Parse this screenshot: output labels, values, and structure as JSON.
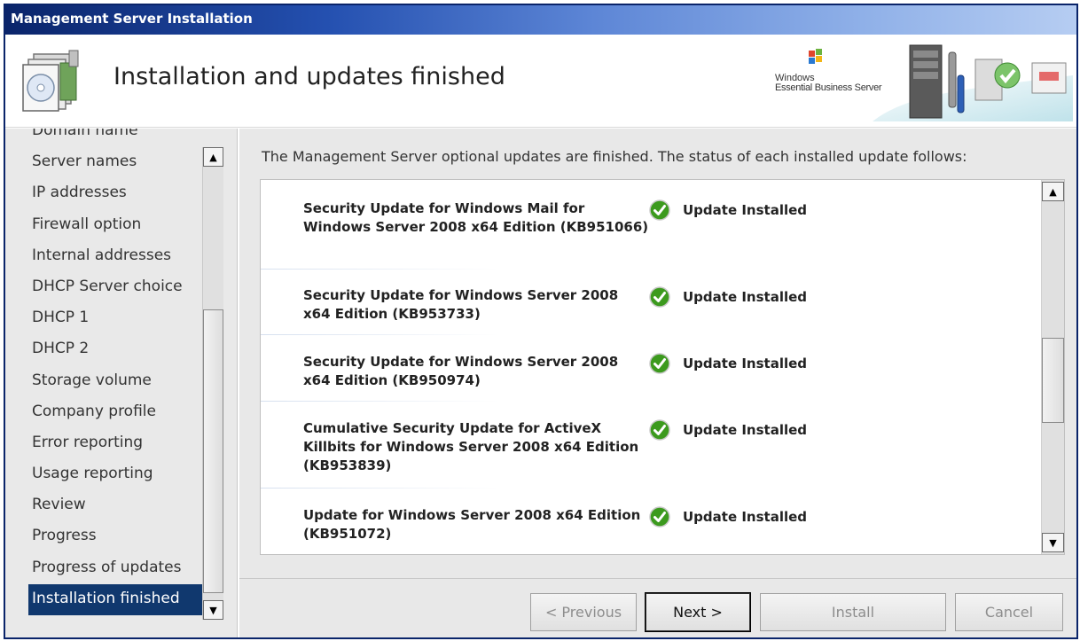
{
  "window": {
    "title": "Management Server Installation"
  },
  "header": {
    "page_title": "Installation and updates finished",
    "brand_line1": "Windows",
    "brand_line2": "Essential Business Server"
  },
  "sidebar": {
    "items": [
      {
        "label": "Domain name"
      },
      {
        "label": "Server names"
      },
      {
        "label": "IP addresses"
      },
      {
        "label": "Firewall option"
      },
      {
        "label": "Internal addresses"
      },
      {
        "label": "DHCP Server choice"
      },
      {
        "label": "DHCP 1"
      },
      {
        "label": "DHCP 2"
      },
      {
        "label": "Storage volume"
      },
      {
        "label": "Company profile"
      },
      {
        "label": "Error reporting"
      },
      {
        "label": "Usage reporting"
      },
      {
        "label": "Review"
      },
      {
        "label": "Progress"
      },
      {
        "label": "Progress of updates"
      },
      {
        "label": "Installation finished",
        "active": true
      }
    ]
  },
  "main": {
    "intro": "The Management Server optional updates are finished. The status of each installed update follows:",
    "updates": [
      {
        "name": "Security Update for Windows Mail for Windows Server 2008 x64 Edition (KB951066)",
        "status": "Update Installed"
      },
      {
        "name": "Security Update for Windows Server 2008 x64 Edition (KB953733)",
        "status": "Update Installed"
      },
      {
        "name": "Security Update for Windows Server 2008 x64 Edition (KB950974)",
        "status": "Update Installed"
      },
      {
        "name": "Cumulative Security Update for ActiveX Killbits for Windows Server 2008 x64 Edition (KB953839)",
        "status": "Update Installed"
      },
      {
        "name": "Update for Windows Server 2008 x64 Edition (KB951072)",
        "status": "Update Installed"
      }
    ]
  },
  "buttons": {
    "previous": "< Previous",
    "next": "Next >",
    "install": "Install",
    "cancel": "Cancel"
  },
  "colors": {
    "titlebar": "#0a246a",
    "selection": "#10386e",
    "success": "#3c9a1e"
  }
}
